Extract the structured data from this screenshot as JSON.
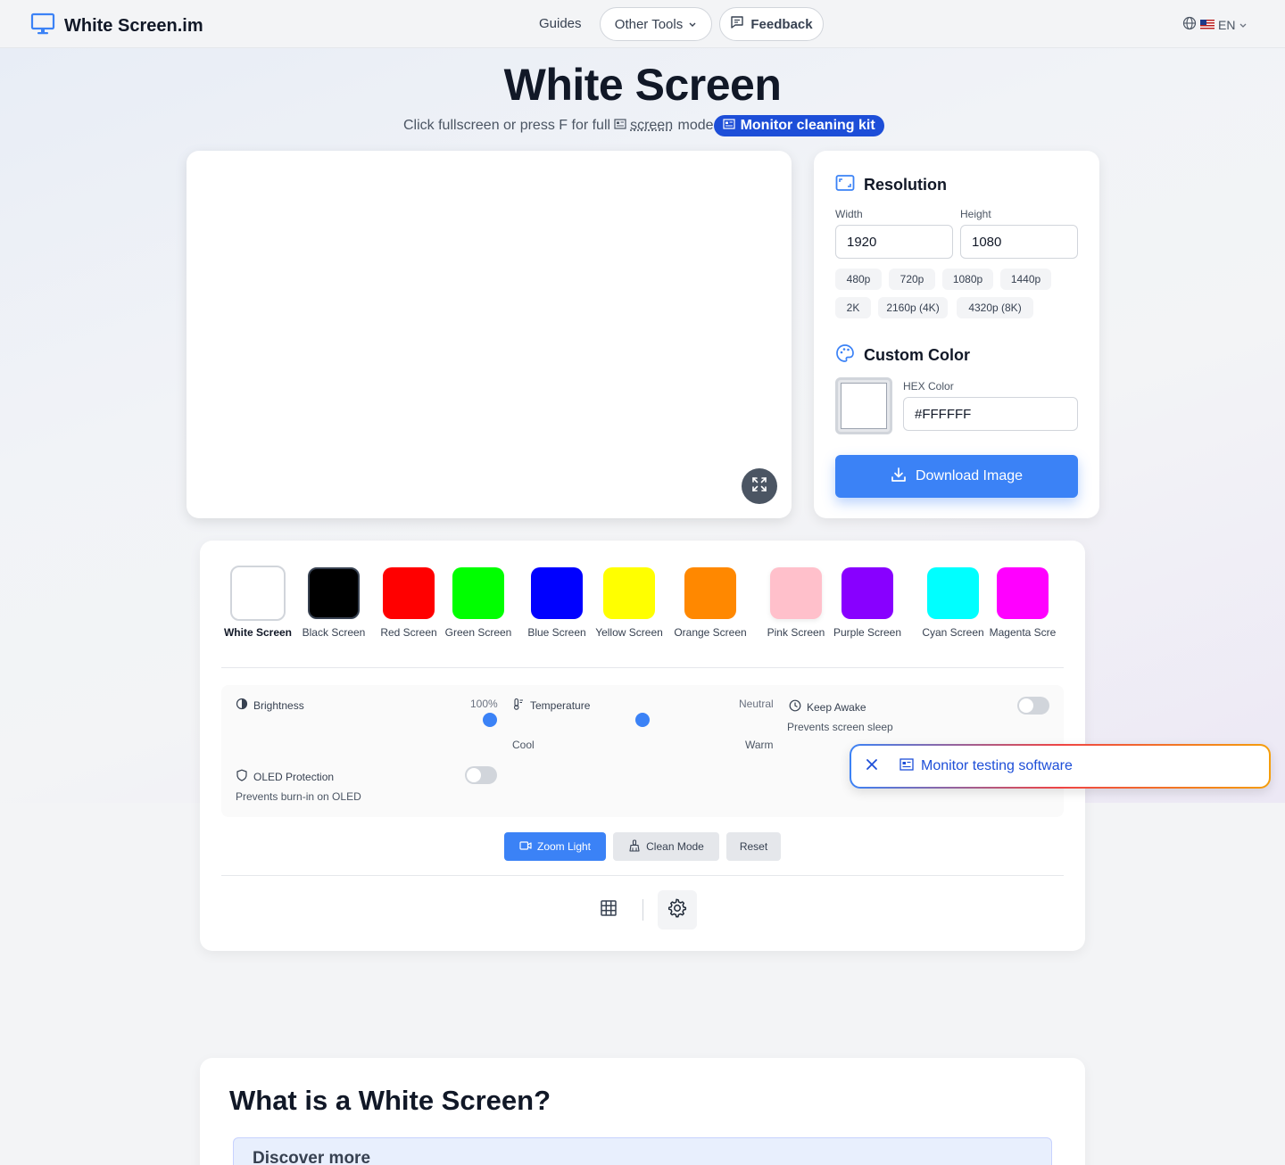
{
  "header": {
    "logo_text": "White Screen.im",
    "nav_guides": "Guides",
    "nav_other_tools": "Other Tools",
    "nav_feedback": "Feedback",
    "language": "EN"
  },
  "hero": {
    "title": "White Screen",
    "subtitle_prefix": "Click fullscreen or press F for full",
    "subtitle_link": "screen",
    "subtitle_suffix": " mode",
    "ad_pill": "Monitor cleaning kit"
  },
  "preview": {
    "background_color": "#FFFFFF"
  },
  "resolution": {
    "title": "Resolution",
    "width_label": "Width",
    "height_label": "Height",
    "width_value": "1920",
    "height_value": "1080",
    "presets": [
      "480p",
      "720p",
      "1080p",
      "1440p",
      "2K",
      "2160p (4K)",
      "4320p (8K)"
    ]
  },
  "custom_color": {
    "title": "Custom Color",
    "hex_label": "HEX Color",
    "hex_value": "#FFFFFF"
  },
  "download_button": "Download Image",
  "colors": [
    {
      "label": "White Screen",
      "hex": "#FFFFFF"
    },
    {
      "label": "Black Screen",
      "hex": "#000000"
    },
    {
      "label": "Red Screen",
      "hex": "#FF0000"
    },
    {
      "label": "Green Screen",
      "hex": "#00FF00"
    },
    {
      "label": "Blue Screen",
      "hex": "#0000FF"
    },
    {
      "label": "Yellow Screen",
      "hex": "#FFFF00"
    },
    {
      "label": "Orange Screen",
      "hex": "#FF8800"
    },
    {
      "label": "Pink Screen",
      "hex": "#FFC0CB"
    },
    {
      "label": "Purple Screen",
      "hex": "#8800FF"
    },
    {
      "label": "Cyan Screen",
      "hex": "#00FFFF"
    },
    {
      "label": "Magenta Scre",
      "hex": "#FF00FF"
    }
  ],
  "settings": {
    "brightness_label": "Brightness",
    "brightness_value": "100%",
    "brightness_level": 1.0,
    "temperature_label": "Temperature",
    "temperature_value": "Neutral",
    "temperature_min": "Cool",
    "temperature_max": "Warm",
    "keep_awake_label": "Keep Awake",
    "keep_awake_desc": "Prevents screen sleep",
    "keep_awake_on": false,
    "oled_label": "OLED Protection",
    "oled_desc": "Prevents burn-in on OLED",
    "oled_on": false
  },
  "actions": {
    "zoom_light": "Zoom Light",
    "clean_mode": "Clean Mode",
    "reset": "Reset"
  },
  "toast": {
    "text": "Monitor testing software"
  },
  "article": {
    "heading": "What is a White Screen?",
    "discover": "Discover more"
  },
  "accent_color": "#3B82F6"
}
